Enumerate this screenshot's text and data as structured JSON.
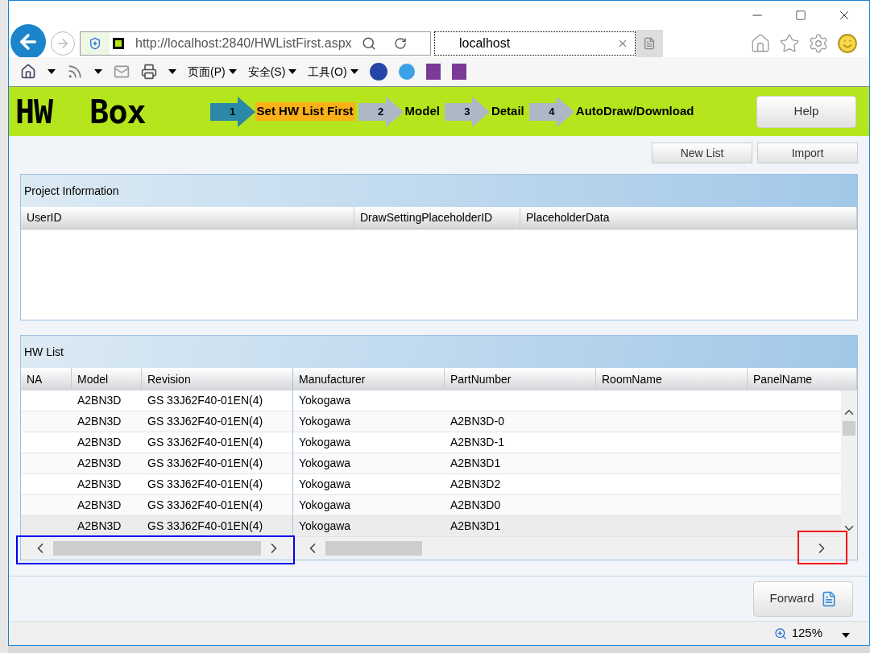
{
  "browser": {
    "address": "http://localhost:2840/HWListFirst.aspx",
    "tab_title": "localhost",
    "menus": [
      {
        "label": "页面(P)"
      },
      {
        "label": "安全(S)"
      },
      {
        "label": "工具(O)"
      }
    ],
    "zoom": "125%"
  },
  "header": {
    "logo": "HW  Box",
    "steps": [
      {
        "number": "1",
        "label": "Set HW List First",
        "selected": true
      },
      {
        "number": "2",
        "label": "Model",
        "selected": false
      },
      {
        "number": "3",
        "label": "Detail",
        "selected": false
      },
      {
        "number": "4",
        "label": "AutoDraw/Download",
        "selected": false
      }
    ],
    "help": "Help"
  },
  "actions": [
    "New List",
    "Import"
  ],
  "project_panel": {
    "title": "Project Information",
    "columns": [
      "UserID",
      "DrawSettingPlaceholderID",
      "PlaceholderData"
    ]
  },
  "hw_panel": {
    "title": "HW List",
    "frozen_columns": [
      "NA",
      "Model",
      "Revision"
    ],
    "columns": [
      "Manufacturer",
      "PartNumber",
      "RoomName",
      "PanelName"
    ],
    "rows": [
      {
        "na": "",
        "model": "A2BN3D",
        "revision": "GS 33J62F40-01EN(4)",
        "manufacturer": "Yokogawa",
        "part": "",
        "selected": false
      },
      {
        "na": "",
        "model": "A2BN3D",
        "revision": "GS 33J62F40-01EN(4)",
        "manufacturer": "Yokogawa",
        "part": "A2BN3D-0",
        "selected": false
      },
      {
        "na": "",
        "model": "A2BN3D",
        "revision": "GS 33J62F40-01EN(4)",
        "manufacturer": "Yokogawa",
        "part": "A2BN3D-1",
        "selected": false
      },
      {
        "na": "",
        "model": "A2BN3D",
        "revision": "GS 33J62F40-01EN(4)",
        "manufacturer": "Yokogawa",
        "part": "A2BN3D1",
        "selected": false
      },
      {
        "na": "",
        "model": "A2BN3D",
        "revision": "GS 33J62F40-01EN(4)",
        "manufacturer": "Yokogawa",
        "part": "A2BN3D2",
        "selected": false
      },
      {
        "na": "",
        "model": "A2BN3D",
        "revision": "GS 33J62F40-01EN(4)",
        "manufacturer": "Yokogawa",
        "part": "A2BN3D0",
        "selected": false
      },
      {
        "na": "",
        "model": "A2BN3D",
        "revision": "GS 33J62F40-01EN(4)",
        "manufacturer": "Yokogawa",
        "part": "A2BN3D1",
        "selected": true
      }
    ]
  },
  "forward": "Forward"
}
